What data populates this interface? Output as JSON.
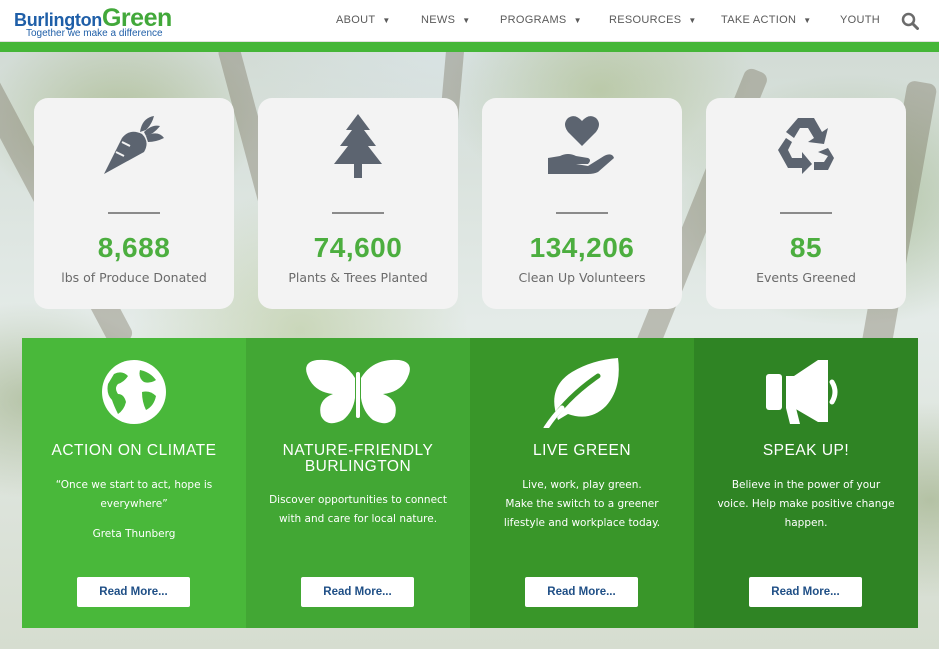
{
  "header": {
    "logo": {
      "word1": "Burlington",
      "word2": "Green",
      "tagline": "Together we make a difference"
    },
    "nav": [
      {
        "label": "ABOUT",
        "has_dropdown": true
      },
      {
        "label": "NEWS",
        "has_dropdown": true
      },
      {
        "label": "PROGRAMS",
        "has_dropdown": true
      },
      {
        "label": "RESOURCES",
        "has_dropdown": true
      },
      {
        "label": "TAKE ACTION",
        "has_dropdown": true
      },
      {
        "label": "YOUTH",
        "has_dropdown": false
      }
    ],
    "search_icon": "search-icon",
    "caret": "▼"
  },
  "stats": [
    {
      "icon": "carrot-icon",
      "value": "8,688",
      "label": "lbs of Produce Donated"
    },
    {
      "icon": "tree-icon",
      "value": "74,600",
      "label": "Plants & Trees Planted"
    },
    {
      "icon": "hand-heart-icon",
      "value": "134,206",
      "label": "Clean Up Volunteers"
    },
    {
      "icon": "recycle-icon",
      "value": "85",
      "label": "Events Greened"
    }
  ],
  "features": [
    {
      "icon": "globe-icon",
      "title": "ACTION ON CLIMATE",
      "text": "“Once we start to act, hope is everywhere”",
      "author": "Greta Thunberg",
      "button": "Read More...",
      "color": "#49b83a"
    },
    {
      "icon": "butterfly-icon",
      "title": "NATURE-FRIENDLY BURLINGTON",
      "text": "Discover opportunities to connect with and care for local nature.",
      "button": "Read More...",
      "color": "#42a734"
    },
    {
      "icon": "leaf-icon",
      "title": "LIVE GREEN",
      "text_lines": [
        "Live, work, play green.",
        "Make the switch to a greener lifestyle and workplace today."
      ],
      "button": "Read More...",
      "color": "#399629"
    },
    {
      "icon": "megaphone-icon",
      "title": "SPEAK UP!",
      "text": "Believe in the power of your voice. Help make positive change happen.",
      "button": "Read More...",
      "color": "#2f8424"
    }
  ],
  "colors": {
    "accent_green": "#45b638",
    "stat_number": "#4cae3f",
    "logo_blue": "#1f5fa8",
    "button_text": "#1f4f86"
  }
}
